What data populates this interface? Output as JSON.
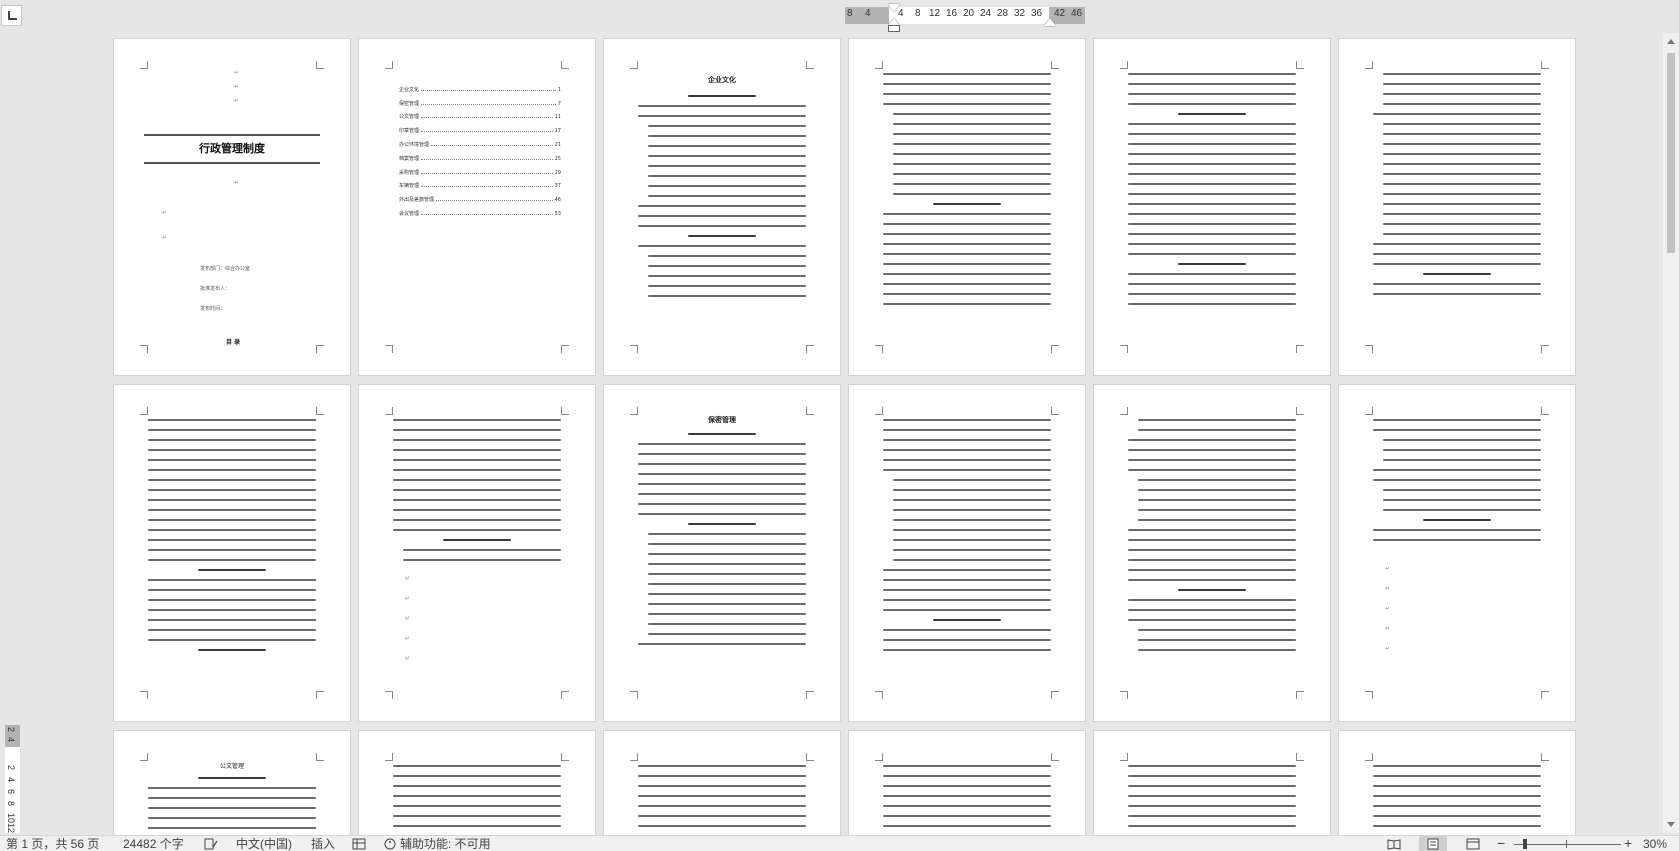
{
  "ruler": {
    "left_ticks": [
      "8",
      "4"
    ],
    "ticks": [
      "4",
      "8",
      "12",
      "16",
      "20",
      "24",
      "28",
      "32",
      "36"
    ],
    "right_ticks": [
      "42",
      "46"
    ],
    "vertical_ticks": [
      "2",
      "4",
      "2",
      "4",
      "6",
      "8",
      "10",
      "12"
    ]
  },
  "cover": {
    "title": "行政管理制度",
    "dept": "发布部门：综合办公室",
    "approver": "批准发布人：",
    "date": "发布时间：",
    "bottom": "目 录"
  },
  "toc": {
    "entries": [
      {
        "label": "企业文化",
        "page": "1"
      },
      {
        "label": "保密管理",
        "page": "7"
      },
      {
        "label": "公文管理",
        "page": "11"
      },
      {
        "label": "印章管理",
        "page": "17"
      },
      {
        "label": "办公环境管理",
        "page": "21"
      },
      {
        "label": "档案管理",
        "page": "25"
      },
      {
        "label": "采购管理",
        "page": "29"
      },
      {
        "label": "车辆管理",
        "page": "37"
      },
      {
        "label": "外出及差旅管理",
        "page": "46"
      },
      {
        "label": "会议管理",
        "page": "53"
      }
    ]
  },
  "headings": {
    "page3": "企业文化",
    "page9": "保密管理",
    "page13": "公文管理"
  },
  "status": {
    "page_info": "第 1 页，共 56 页",
    "word_count": "24482 个字",
    "language": "中文(中国)",
    "mode": "插入",
    "accessibility": "辅助功能: 不可用",
    "zoom": "30%",
    "zoom_minus": "−",
    "zoom_plus": "+"
  }
}
